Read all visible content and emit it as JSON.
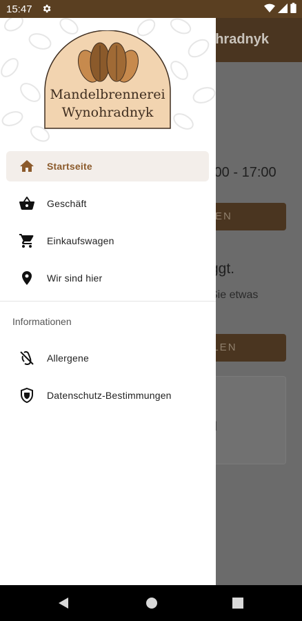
{
  "status_bar": {
    "time": "15:47"
  },
  "background": {
    "toolbar_title": "ohradnyk",
    "opening_hours": ":00 - 17:00",
    "button1_label": "EN",
    "empty_text": "ggt.",
    "hint_text": "Sie etwas",
    "button2_label": "LLEN",
    "card_mark": "l"
  },
  "drawer": {
    "logo_line1": "Mandelbrennerei",
    "logo_line2": "Wynohradnyk",
    "items": [
      {
        "label": "Startseite",
        "icon": "home-icon",
        "active": true
      },
      {
        "label": "Geschäft",
        "icon": "shopping-basket-icon"
      },
      {
        "label": "Einkaufswagen",
        "icon": "cart-icon"
      },
      {
        "label": "Wir sind hier",
        "icon": "location-pin-icon"
      }
    ],
    "section_title": "Informationen",
    "info_items": [
      {
        "label": "Allergene",
        "icon": "allergen-icon"
      },
      {
        "label": "Datenschutz-Bestimmungen",
        "icon": "shield-icon"
      }
    ]
  },
  "colors": {
    "brand_brown": "#5a3f21",
    "active_text": "#8b5a2b",
    "active_bg": "#f3eeea"
  }
}
